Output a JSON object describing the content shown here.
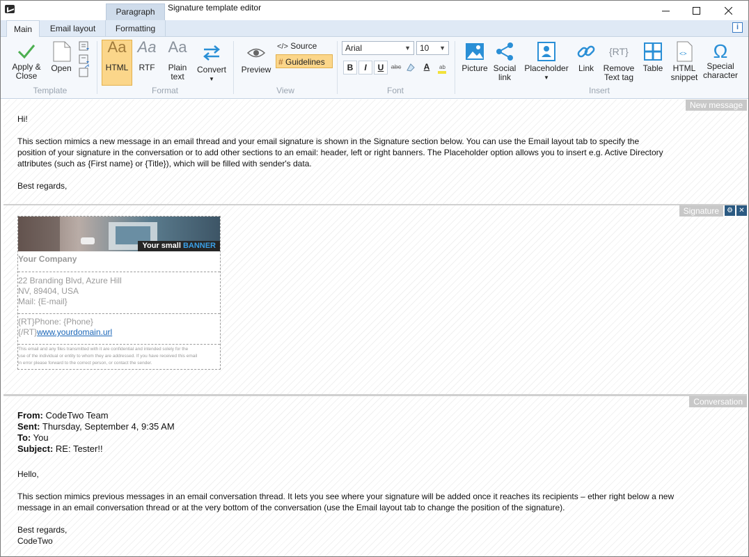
{
  "window": {
    "title": "Signature template editor",
    "context_tab": "Paragraph"
  },
  "tabs": [
    {
      "label": "Main"
    },
    {
      "label": "Email layout"
    },
    {
      "label": "Formatting"
    }
  ],
  "info_label": "i",
  "ribbon": {
    "template": {
      "label": "Template",
      "apply": "Apply &",
      "apply2": "Close",
      "open": "Open"
    },
    "format": {
      "label": "Format",
      "html": "HTML",
      "rtf": "RTF",
      "plain": "Plain",
      "plain2": "text",
      "convert": "Convert"
    },
    "view": {
      "label": "View",
      "preview": "Preview",
      "source": "Source",
      "guidelines": "Guidelines"
    },
    "font": {
      "label": "Font",
      "family": "Arial",
      "size": "10"
    },
    "insert": {
      "label": "Insert",
      "picture": "Picture",
      "social": "Social",
      "social2": "link",
      "placeholder": "Placeholder",
      "link": "Link",
      "remove": "Remove",
      "remove2": "Text tag",
      "table": "Table",
      "snippet": "HTML",
      "snippet2": "snippet",
      "special": "Special",
      "special2": "character"
    }
  },
  "new_message": {
    "label": "New message",
    "greeting": "Hi!",
    "line1": "This section mimics a new message in an email thread and your email signature is shown in the Signature section below. You can use the Email layout tab to specify the",
    "line2": "position of your signature in the conversation or to add other sections to an email: header, left or right banners. The Placeholder option allows you to insert e.g. Active Directory",
    "line3": "attributes (such as {First name} or {Title}), which will be filled with sender's data.",
    "closing": "Best regards,"
  },
  "signature": {
    "label": "Signature",
    "banner_a": "Your small ",
    "banner_b": "BANNER",
    "company": "Your Company",
    "addr1": "22 Branding Blvd, Azure Hill",
    "addr2": "NV, 89404, USA",
    "mail": "Mail: {E-mail}",
    "phone": "{RT}Phone: {Phone}",
    "rt_close": "{/RT}",
    "url": "www.yourdomain.url",
    "disclaimer1": "This email and any files transmitted with it are confidential and intended solely for the",
    "disclaimer2": "use of the individual or entity to whom they are addressed. If you have received this email",
    "disclaimer3": "in error please forward to the correct person, or contact the sender."
  },
  "conversation": {
    "label": "Conversation",
    "from_k": "From:",
    "from_v": " CodeTwo Team",
    "sent_k": "Sent:",
    "sent_v": " Thursday, September 4, 9:35 AM",
    "to_k": "To:",
    "to_v": " You",
    "subj_k": "Subject:",
    "subj_v": " RE: Tester!!",
    "hello": "Hello,",
    "body1": "This section mimics previous messages in an email conversation thread. It lets you see where your signature will be added once it reaches its recipients – ether right below a new",
    "body2": "message in an email conversation thread or at the very bottom of the conversation (use the Email layout tab to change the position of the signature).",
    "closing": "Best regards,",
    "sender": "CodeTwo"
  }
}
